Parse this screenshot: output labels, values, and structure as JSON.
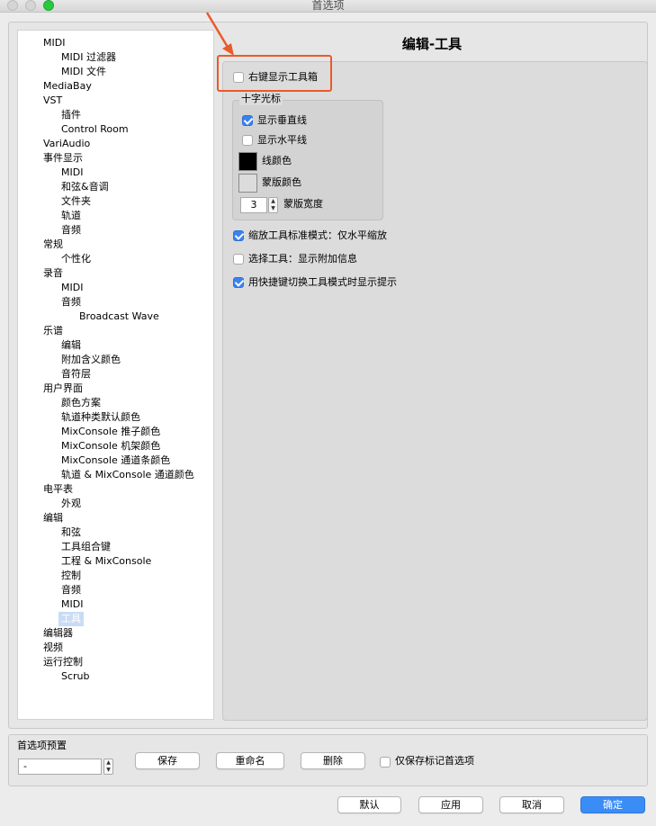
{
  "window": {
    "title": "首选项"
  },
  "tree": [
    {
      "label": "MIDI",
      "level": 0
    },
    {
      "label": "MIDI 过滤器",
      "level": 1
    },
    {
      "label": "MIDI 文件",
      "level": 1
    },
    {
      "label": "MediaBay",
      "level": 0
    },
    {
      "label": "VST",
      "level": 0
    },
    {
      "label": "插件",
      "level": 1
    },
    {
      "label": "Control Room",
      "level": 1
    },
    {
      "label": "VariAudio",
      "level": 0
    },
    {
      "label": "事件显示",
      "level": 0
    },
    {
      "label": "MIDI",
      "level": 1
    },
    {
      "label": "和弦&音调",
      "level": 1
    },
    {
      "label": "文件夹",
      "level": 1
    },
    {
      "label": "轨道",
      "level": 1
    },
    {
      "label": "音频",
      "level": 1
    },
    {
      "label": "常规",
      "level": 0
    },
    {
      "label": "个性化",
      "level": 1
    },
    {
      "label": "录音",
      "level": 0
    },
    {
      "label": "MIDI",
      "level": 1
    },
    {
      "label": "音频",
      "level": 1
    },
    {
      "label": "Broadcast Wave",
      "level": 2
    },
    {
      "label": "乐谱",
      "level": 0
    },
    {
      "label": "编辑",
      "level": 1
    },
    {
      "label": "附加含义颜色",
      "level": 1
    },
    {
      "label": "音符层",
      "level": 1
    },
    {
      "label": "用户界面",
      "level": 0
    },
    {
      "label": "颜色方案",
      "level": 1
    },
    {
      "label": "轨道种类默认颜色",
      "level": 1
    },
    {
      "label": "MixConsole 推子颜色",
      "level": 1
    },
    {
      "label": "MixConsole 机架颜色",
      "level": 1
    },
    {
      "label": "MixConsole 通道条颜色",
      "level": 1
    },
    {
      "label": "轨道 & MixConsole 通道颜色",
      "level": 1
    },
    {
      "label": "电平表",
      "level": 0
    },
    {
      "label": "外观",
      "level": 1
    },
    {
      "label": "编辑",
      "level": 0
    },
    {
      "label": "和弦",
      "level": 1
    },
    {
      "label": "工具组合键",
      "level": 1
    },
    {
      "label": "工程 & MixConsole",
      "level": 1
    },
    {
      "label": "控制",
      "level": 1
    },
    {
      "label": "音频",
      "level": 1
    },
    {
      "label": "MIDI",
      "level": 1
    },
    {
      "label": "工具",
      "level": 1,
      "selected": true
    },
    {
      "label": "编辑器",
      "level": 0
    },
    {
      "label": "视频",
      "level": 0
    },
    {
      "label": "运行控制",
      "level": 0
    },
    {
      "label": "Scrub",
      "level": 1
    }
  ],
  "page": {
    "heading": "编辑-工具",
    "right_click_toolbox": {
      "label": "右键显示工具箱",
      "checked": false
    },
    "crosshair": {
      "title": "十字光标",
      "show_vertical": {
        "label": "显示垂直线",
        "checked": true
      },
      "show_horizontal": {
        "label": "显示水平线",
        "checked": false
      },
      "line_color": {
        "label": "线颜色",
        "color": "#000000"
      },
      "mask_color": {
        "label": "蒙版颜色",
        "color": "#dcdcdc"
      },
      "mask_width": {
        "label": "蒙版宽度",
        "value": "3"
      }
    },
    "zoom_standard": {
      "label": "缩放工具标准模式：仅水平缩放",
      "checked": true
    },
    "select_tool_info": {
      "label": "选择工具：显示附加信息",
      "checked": false
    },
    "shortcut_hint": {
      "label": "用快捷键切换工具模式时显示提示",
      "checked": true
    }
  },
  "presets": {
    "title": "首选项预置",
    "selected": "-",
    "save": "保存",
    "rename": "重命名",
    "delete": "删除",
    "only_marked": {
      "label": "仅保存标记首选项",
      "checked": false
    }
  },
  "footer": {
    "default": "默认",
    "apply": "应用",
    "cancel": "取消",
    "ok": "确定"
  },
  "colors": {
    "accent": "#3b82f0",
    "selection": "#c9dcf5",
    "annotation": "#ea5a2c"
  }
}
